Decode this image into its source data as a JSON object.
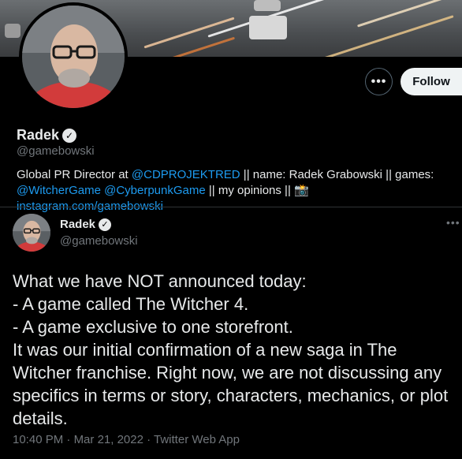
{
  "profile": {
    "name": "Radek",
    "handle": "@gamebowski",
    "more_label": "•••",
    "follow_label": "Follow",
    "bio": {
      "t1": "Global PR Director at ",
      "l1": "@CDPROJEKTRED",
      "t2": " || name: Radek Grabowski || games: ",
      "l2": "@WitcherGame",
      "t3": " ",
      "l3": "@CyberpunkGame",
      "t4": " || my opinions || ",
      "emoji": "📸",
      "t5": " ",
      "l4": "instagram.com/gamebowski"
    }
  },
  "tweet": {
    "name": "Radek",
    "handle": "@gamebowski",
    "more_label": "•••",
    "text": "What we have NOT announced today:\n- A game called The Witcher 4.\n- A game exclusive to one storefront.\nIt was our initial confirmation of a new saga in The Witcher franchise. Right now, we are not discussing any specifics in terms or story, characters, mechanics, or plot details.",
    "time": "10:40 PM",
    "sep": " · ",
    "date": "Mar 21, 2022",
    "sep2": " · ",
    "source": "Twitter Web App"
  },
  "icons": {
    "verified": "verified-badge-icon",
    "more": "more-horizontal-icon"
  },
  "colors": {
    "background": "#000000",
    "text": "#e7e9ea",
    "secondary": "#71767b",
    "link": "#1d9bf0",
    "follow_bg": "#eff3f4"
  }
}
